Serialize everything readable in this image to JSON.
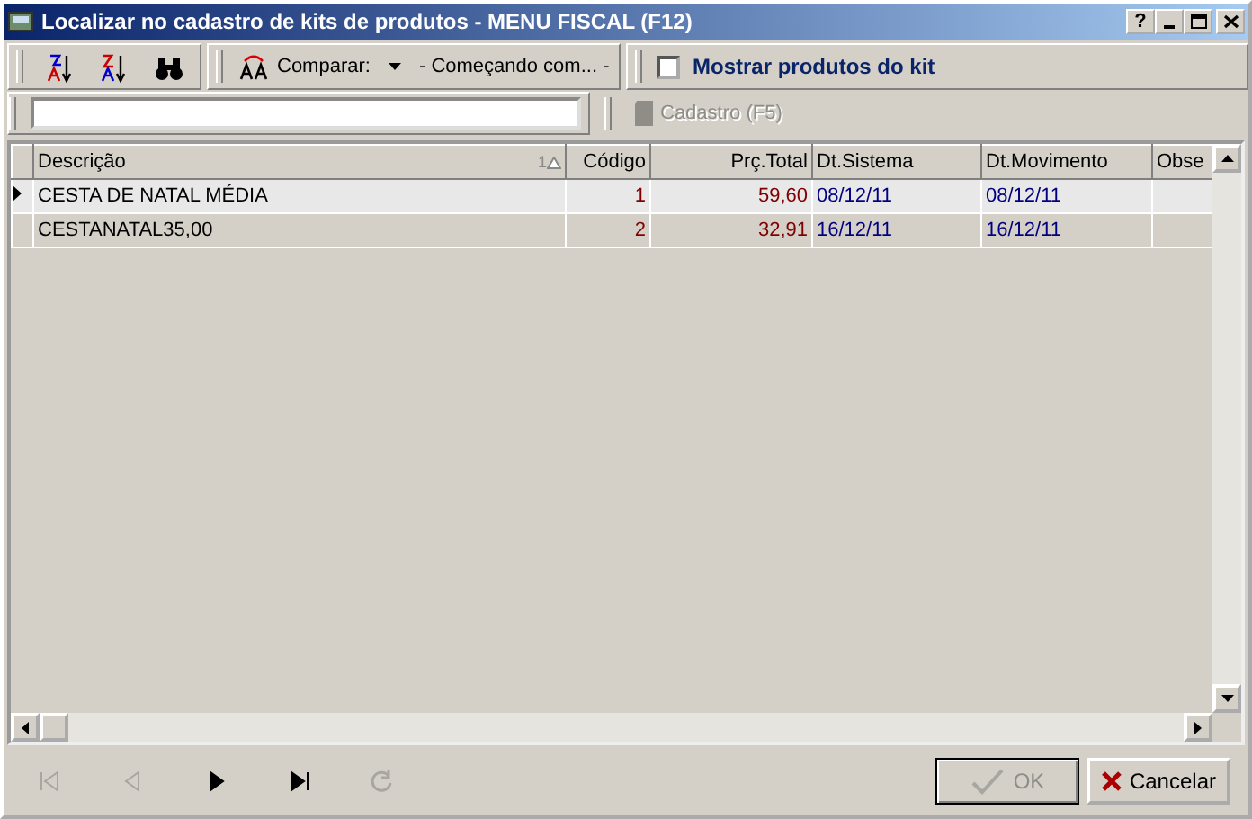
{
  "window": {
    "title": "Localizar no cadastro de kits de produtos - MENU FISCAL (F12)"
  },
  "title_buttons": [
    {
      "kind": "help",
      "label": "?"
    },
    {
      "kind": "minimize"
    },
    {
      "kind": "maximize"
    },
    {
      "kind": "close"
    }
  ],
  "toolbar": {
    "tools": [
      {
        "kind": "sort-asc"
      },
      {
        "kind": "sort-desc"
      },
      {
        "kind": "find"
      }
    ],
    "compare_label": "Comparar:",
    "compare_value": "- Começando com... -",
    "checkbox": {
      "label": "Mostrar produtos do kit",
      "checked": false
    }
  },
  "search": {
    "cadastro_button": {
      "label": "Cadastro (F5)",
      "disabled": true
    }
  },
  "table": {
    "columns": [
      {
        "label": "Descrição",
        "kind": "text",
        "sort_index": "1"
      },
      {
        "label": "Código",
        "kind": "code"
      },
      {
        "label": "Prç.Total",
        "kind": "money"
      },
      {
        "label": "Dt.Sistema",
        "kind": "date"
      },
      {
        "label": "Dt.Movimento",
        "kind": "date"
      },
      {
        "label": "Obse",
        "kind": "empty"
      }
    ],
    "rows": [
      {
        "selected": true,
        "cells": [
          "CESTA DE NATAL MÉDIA",
          "1",
          "59,60",
          "08/12/11",
          "08/12/11"
        ]
      },
      {
        "selected": false,
        "cells": [
          "CESTANATAL35,00",
          "2",
          "32,91",
          "16/12/11",
          "16/12/11"
        ]
      }
    ]
  },
  "navigator": [
    {
      "kind": "first",
      "disabled": true
    },
    {
      "kind": "prev",
      "disabled": true
    },
    {
      "kind": "next",
      "disabled": false
    },
    {
      "kind": "last",
      "disabled": false
    },
    {
      "kind": "refresh",
      "disabled": true
    }
  ],
  "buttons": [
    {
      "kind": "ok",
      "label": "OK",
      "disabled": true
    },
    {
      "kind": "cancel",
      "label": "Cancelar",
      "disabled": false
    }
  ]
}
